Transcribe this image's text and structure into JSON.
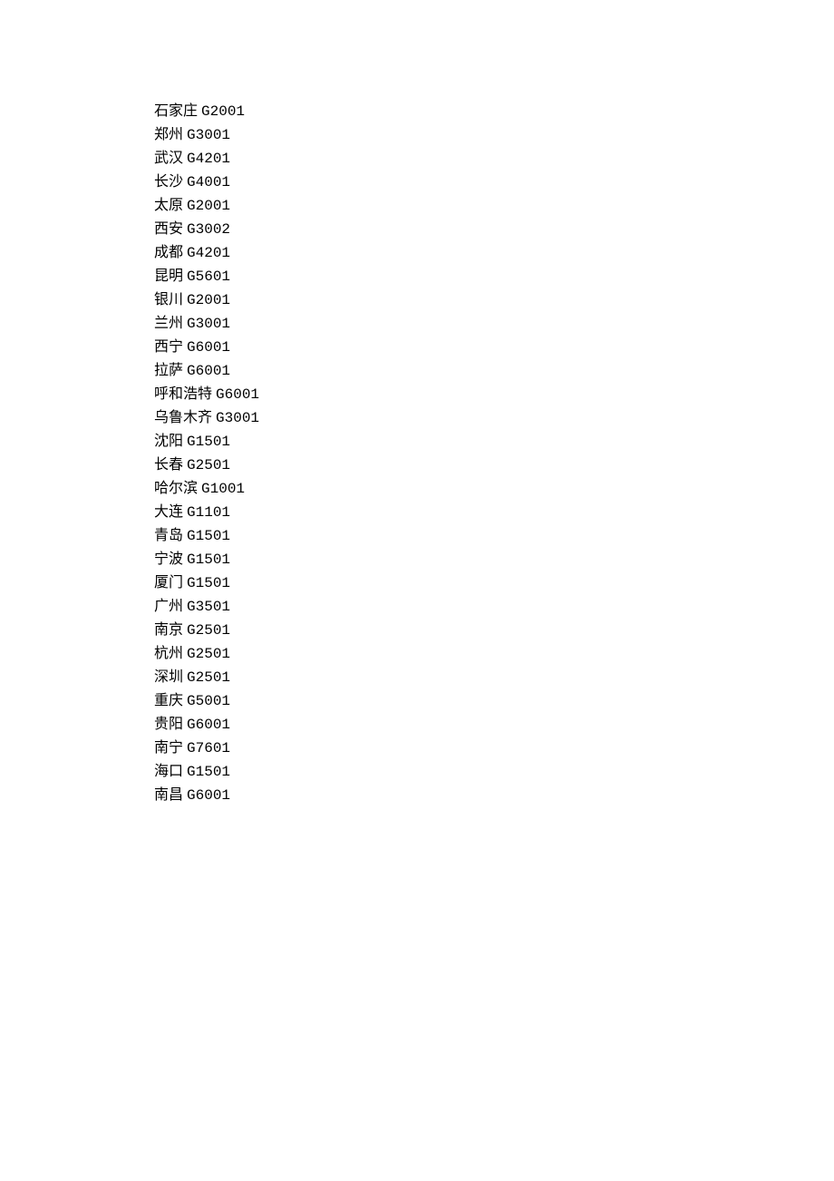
{
  "entries": [
    {
      "city": "石家庄",
      "code": "G2001"
    },
    {
      "city": "郑州",
      "code": "G3001"
    },
    {
      "city": "武汉",
      "code": "G4201"
    },
    {
      "city": "长沙",
      "code": "G4001"
    },
    {
      "city": "太原",
      "code": "G2001"
    },
    {
      "city": "西安",
      "code": "G3002"
    },
    {
      "city": "成都",
      "code": "G4201"
    },
    {
      "city": "昆明",
      "code": "G5601"
    },
    {
      "city": "银川",
      "code": "G2001"
    },
    {
      "city": "兰州",
      "code": "G3001"
    },
    {
      "city": "西宁",
      "code": "G6001"
    },
    {
      "city": "拉萨",
      "code": "G6001"
    },
    {
      "city": "呼和浩特",
      "code": "G6001"
    },
    {
      "city": "乌鲁木齐",
      "code": "G3001"
    },
    {
      "city": "沈阳",
      "code": "G1501"
    },
    {
      "city": "长春",
      "code": "G2501"
    },
    {
      "city": "哈尔滨",
      "code": "G1001"
    },
    {
      "city": "大连",
      "code": "G1101"
    },
    {
      "city": "青岛",
      "code": "G1501"
    },
    {
      "city": "宁波",
      "code": "G1501"
    },
    {
      "city": "厦门",
      "code": "G1501"
    },
    {
      "city": "广州",
      "code": "G3501"
    },
    {
      "city": "南京",
      "code": "G2501"
    },
    {
      "city": "杭州",
      "code": "G2501"
    },
    {
      "city": "深圳",
      "code": "G2501"
    },
    {
      "city": "重庆",
      "code": "G5001"
    },
    {
      "city": "贵阳",
      "code": "G6001"
    },
    {
      "city": "南宁",
      "code": "G7601"
    },
    {
      "city": "海口",
      "code": "G1501"
    },
    {
      "city": "南昌",
      "code": "G6001"
    }
  ]
}
